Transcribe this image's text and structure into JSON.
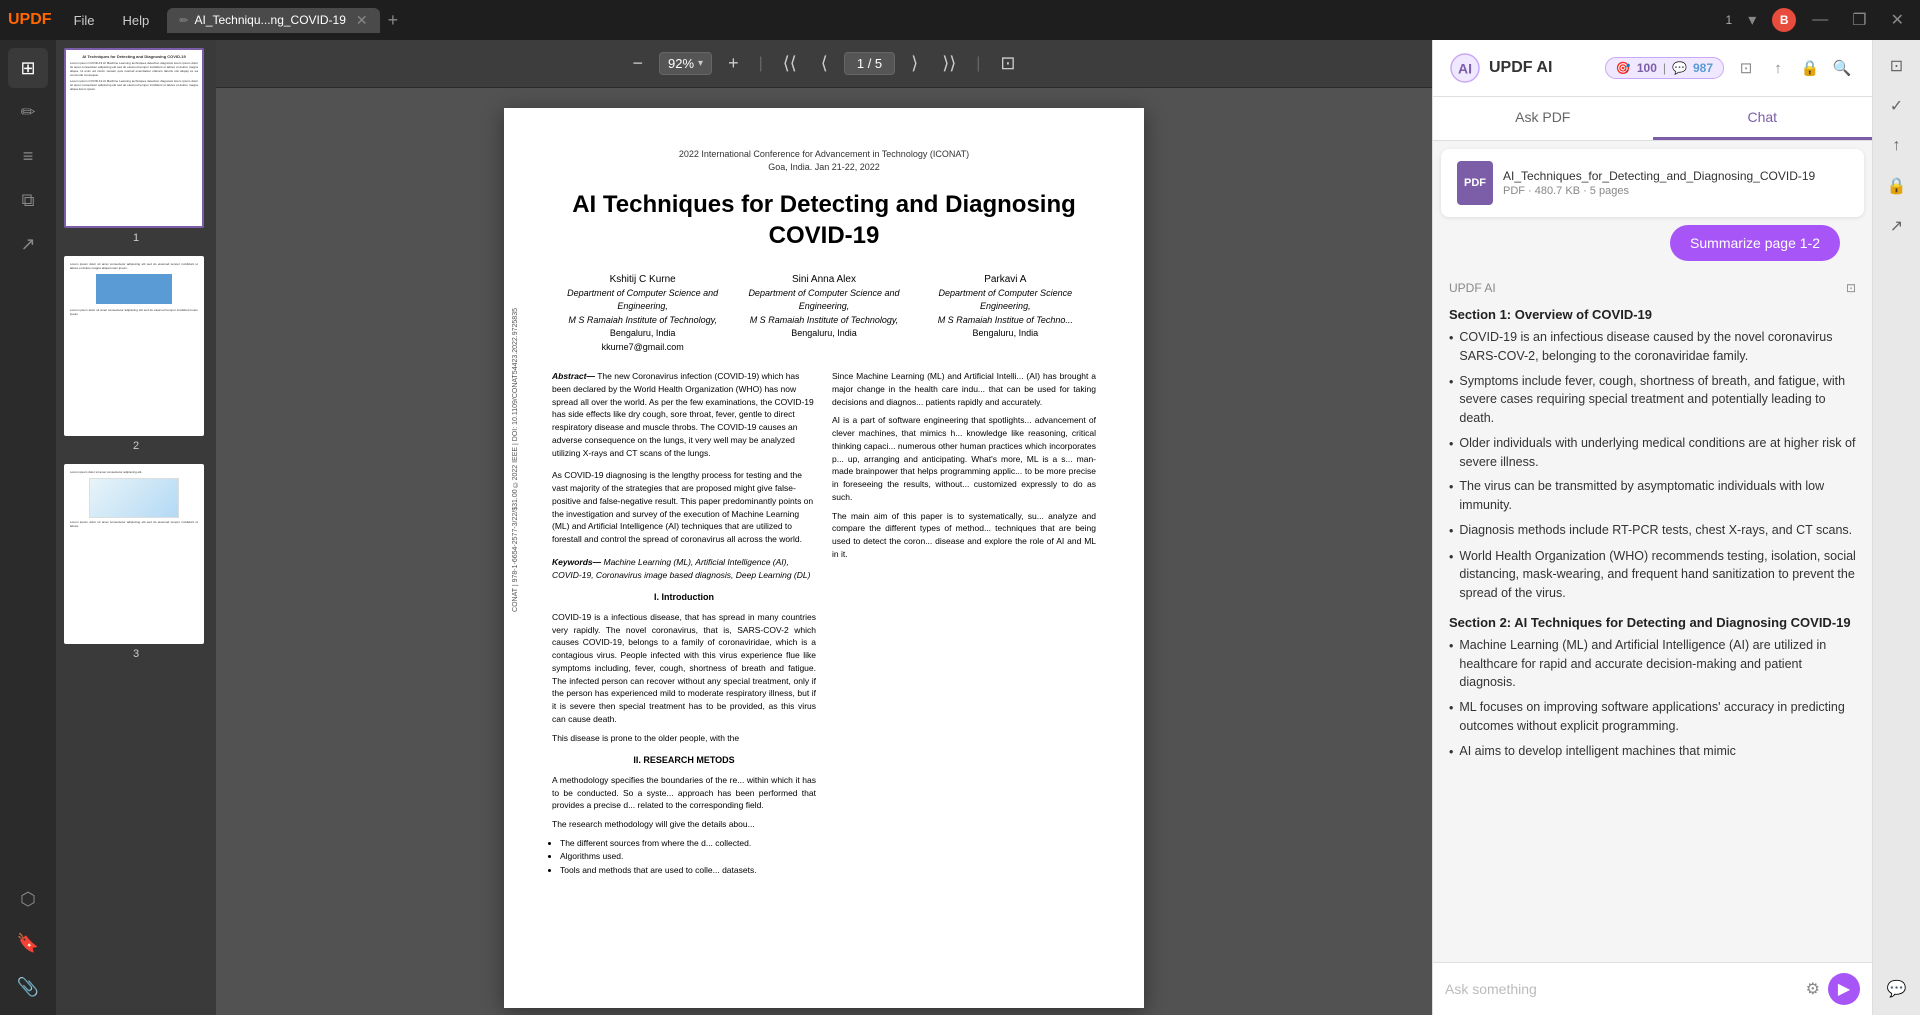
{
  "titlebar": {
    "logo": "UPDF",
    "menu_file": "File",
    "menu_help": "Help",
    "tab_label": "AI_Techniqu...ng_COVID-19",
    "tab_icon": "✏",
    "page_indicator": "1",
    "user_initial": "B",
    "btn_minimize": "—",
    "btn_maximize": "❐",
    "btn_close": "✕",
    "btn_add_tab": "+"
  },
  "toolbar": {
    "zoom_out": "−",
    "zoom_level": "92%",
    "zoom_in": "+",
    "nav_first": "⟨⟨",
    "nav_prev": "⟨",
    "page_current": "1",
    "page_sep": "/",
    "page_total": "5",
    "nav_next": "⟩",
    "nav_last": "⟩⟩",
    "fullscreen": "⊡"
  },
  "sidebar_icons": [
    {
      "name": "thumbnail-view-icon",
      "icon": "⊞"
    },
    {
      "name": "annotate-icon",
      "icon": "✏"
    },
    {
      "name": "edit-icon",
      "icon": "≡"
    },
    {
      "name": "organize-icon",
      "icon": "⧉"
    },
    {
      "name": "export-icon",
      "icon": "↗"
    },
    {
      "name": "plugin-icon",
      "icon": "⬡"
    },
    {
      "name": "bookmark-icon",
      "icon": "🔖"
    },
    {
      "name": "attachment-icon",
      "icon": "📎"
    }
  ],
  "thumbnails": [
    {
      "num": "1",
      "active": true
    },
    {
      "num": "2",
      "active": false
    },
    {
      "num": "3",
      "active": false
    }
  ],
  "pdf": {
    "header_line1": "2022 International Conference for Advancement in Technology (ICONAT)",
    "header_line2": "Goa, India. Jan 21-22, 2022",
    "title": "AI Techniques for Detecting and Diagnosing COVID-19",
    "authors": [
      {
        "name": "Kshitij C Kurne",
        "dept": "Department of Computer Science and Engineering,",
        "institute": "M S Ramaiah Institute of Technology,",
        "city": "Bengaluru, India",
        "email": "kkurne7@gmail.com"
      },
      {
        "name": "Sini Anna Alex",
        "dept": "Department of Computer Science and Engineering,",
        "institute": "M S Ramaiah Institute of Technology,",
        "city": "Bengaluru, India",
        "email": ""
      },
      {
        "name": "Parkavi A",
        "dept": "Department of Computer Science Engineering,",
        "institute": "M S Ramaiah Institue of Techno...",
        "city": "Bengaluru, India",
        "email": ""
      }
    ],
    "abstract_label": "Abstract—",
    "abstract_text": "The new Coronavirus infection (COVID-19) which has been declared by the World Health Organization (WHO) has now spread all over the world. As per the few examinations, the COVID-19 has side effects like dry cough, sore throat, fever, gentle to direct respiratory disease and muscle throbs. The COVID-19 causes an adverse consequence on the lungs, it very well may be analyzed utilizing X-rays and CT scans of the lungs.",
    "abstract_p2": "As COVID-19 diagnosing is the lengthy process for testing and the vast majority of the strategies that are proposed might give false-positive and false-negative result. This paper predominantly points on the investigation and survey of the execution of Machine Learning (ML) and Artificial Intelligence (AI) techniques that are utilized to forestall and control the spread of coronavirus all across the world.",
    "keywords_label": "Keywords—",
    "keywords_text": "Machine Learning (ML), Artificial Intelligence (AI), COVID-19, Coronavirus image based diagnosis, Deep Learning (DL)",
    "section1_title": "I. Introduction",
    "intro_p1": "COVID-19 is a infectious disease, that has spread in many countries very rapidly. The novel coronavirus, that is, SARS-COV-2 which causes COVID-19, belongs to a family of coronaviridae, which is a contagious virus. People infected with this virus experience flue like symptoms including, fever, cough, shortness of breath and fatigue. The infected person can recover without any special treatment, only if the person has experienced mild to moderate respiratory illness, but if it is severe then special treatment has to be provided, as this virus can cause death.",
    "intro_p2": "This disease is prone to the older people, with the",
    "section2_title": "II. RESEARCH METODS",
    "research_p1": "A methodology specifies the boundaries of the re... within which it has to be conducted. So a syste... approach has been performed that provides a precise d... related to the corresponding field.",
    "research_p2": "The research methodology will give the details abou...",
    "bullet1": "The different sources from where the d... collected.",
    "bullet2": "Algorithms used.",
    "bullet3": "Tools and methods that are used to colle... datasets.",
    "right_col_p1": "Since Machine Learning (ML) and Artificial Intelli... (AI) has brought a major change in the health care indu... that can be used for taking decisions and diagnos... patients rapidly and accurately.",
    "right_col_p2": "AI is a part of software engineering that spotlights... advancement of clever machines, that mimics h... knowledge like reasoning, critical thinking capaci... numerous other human practices which incorporates p... up, arranging and anticipating. What's more, ML is a s... man-made brainpower that helps programming applic... to be more precise in foreseeing the results, without... customized expressly to do as such.",
    "right_col_p3": "The main aim of this paper is to systematically, su... analyze and compare the different types of method... techniques that are being used to detect the coron... disease and explore the role of AI and ML in it."
  },
  "ai_panel": {
    "title": "UPDF AI",
    "tab_ask_pdf": "Ask PDF",
    "tab_chat": "Chat",
    "counter_100": "100",
    "counter_987": "987",
    "file_name": "AI_Techniques_for_Detecting_and_Diagnosing_COVID-19",
    "file_meta": "PDF · 480.7 KB · 5 pages",
    "file_type_label": "PDF",
    "summarize_btn": "Summarize page 1-2",
    "updf_ai_label": "UPDF AI",
    "section1_title": "Section 1: Overview of COVID-19",
    "section1_bullets": [
      "COVID-19 is an infectious disease caused by the novel coronavirus SARS-COV-2, belonging to the coronaviridae family.",
      "Symptoms include fever, cough, shortness of breath, and fatigue, with severe cases requiring special treatment and potentially leading to death.",
      "Older individuals with underlying medical conditions are at higher risk of severe illness.",
      "The virus can be transmitted by asymptomatic individuals with low immunity.",
      "Diagnosis methods include RT-PCR tests, chest X-rays, and CT scans.",
      "World Health Organization (WHO) recommends testing, isolation, social distancing, mask-wearing, and frequent hand sanitization to prevent the spread of the virus."
    ],
    "section2_title": "Section 2: AI Techniques for Detecting and Diagnosing COVID-19",
    "section2_bullets": [
      "Machine Learning (ML) and Artificial Intelligence (AI) are utilized in healthcare for rapid and accurate decision-making and patient diagnosis.",
      "ML focuses on improving software applications' accuracy in predicting outcomes without explicit programming.",
      "AI aims to develop intelligent machines that mimic"
    ],
    "ask_placeholder": "Ask something",
    "ask_icon": "⚙"
  }
}
